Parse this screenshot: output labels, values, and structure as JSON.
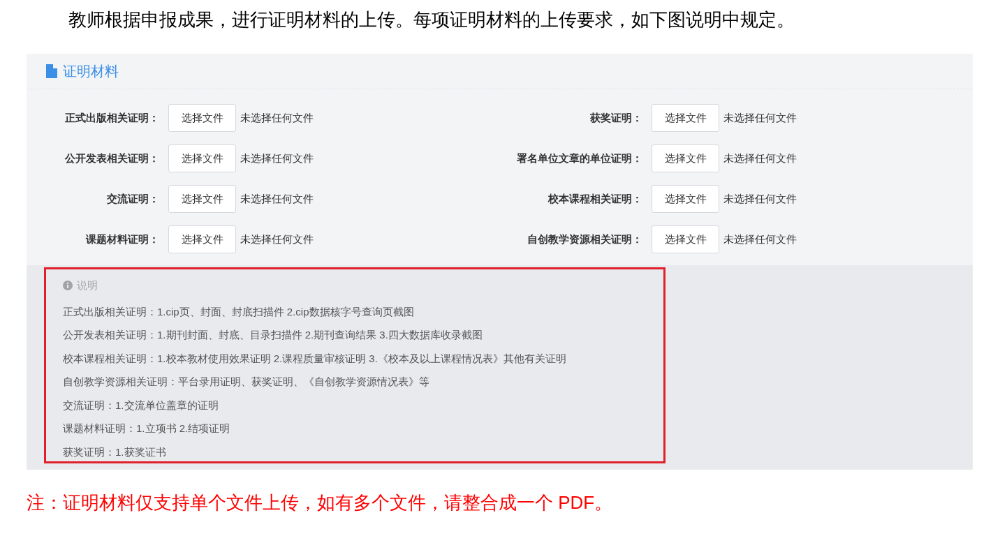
{
  "intro": "教师根据申报成果，进行证明材料的上传。每项证明材料的上传要求，如下图说明中规定。",
  "panel": {
    "title": "证明材料",
    "fields": [
      {
        "label": "正式出版相关证明：",
        "button": "选择文件",
        "status": "未选择任何文件"
      },
      {
        "label": "获奖证明：",
        "button": "选择文件",
        "status": "未选择任何文件"
      },
      {
        "label": "公开发表相关证明：",
        "button": "选择文件",
        "status": "未选择任何文件"
      },
      {
        "label": "署名单位文章的单位证明：",
        "button": "选择文件",
        "status": "未选择任何文件"
      },
      {
        "label": "交流证明：",
        "button": "选择文件",
        "status": "未选择任何文件"
      },
      {
        "label": "校本课程相关证明：",
        "button": "选择文件",
        "status": "未选择任何文件"
      },
      {
        "label": "课题材料证明：",
        "button": "选择文件",
        "status": "未选择任何文件"
      },
      {
        "label": "自创教学资源相关证明：",
        "button": "选择文件",
        "status": "未选择任何文件"
      }
    ],
    "notes": {
      "title": "说明",
      "lines": [
        "正式出版相关证明：1.cip页、封面、封底扫描件 2.cip数据核字号查询页截图",
        "公开发表相关证明：1.期刊封面、封底、目录扫描件 2.期刊查询结果 3.四大数据库收录截图",
        "校本课程相关证明：1.校本教材使用效果证明 2.课程质量审核证明 3.《校本及以上课程情况表》其他有关证明",
        "自创教学资源相关证明：平台录用证明、获奖证明、《自创教学资源情况表》等",
        "交流证明：1.交流单位盖章的证明",
        "课题材料证明：1.立项书 2.结项证明",
        "获奖证明：1.获奖证书"
      ]
    }
  },
  "footnote": "注：证明材料仅支持单个文件上传，如有多个文件，请整合成一个 PDF。"
}
